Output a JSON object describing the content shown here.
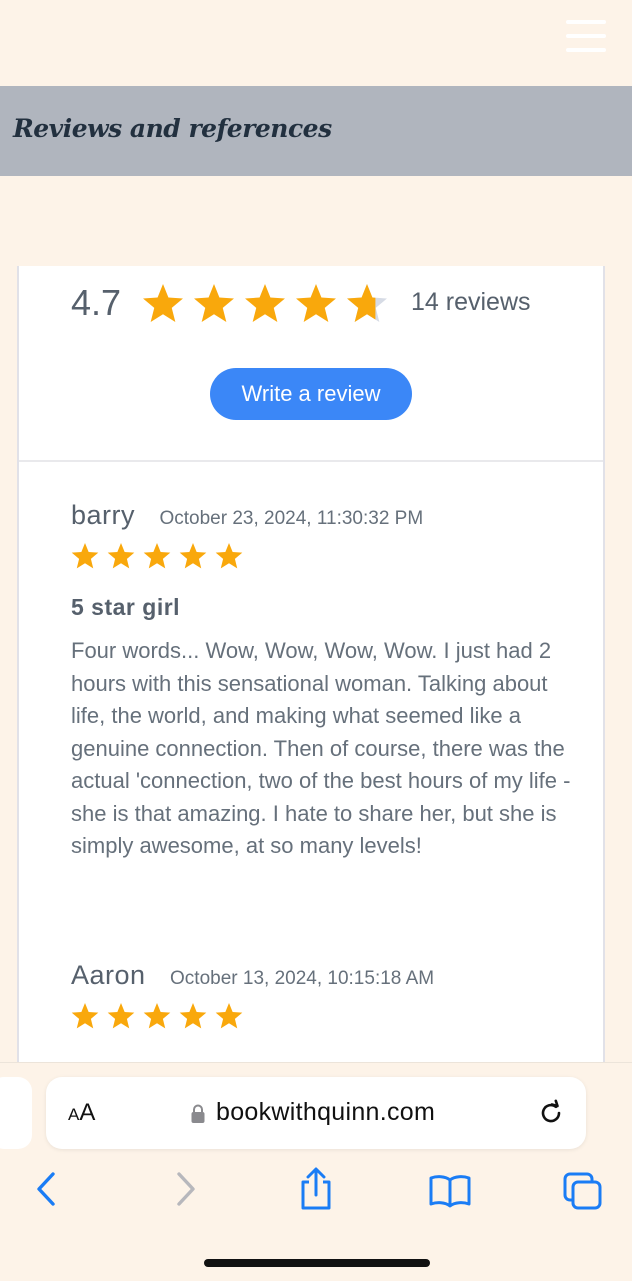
{
  "header": {
    "menu_icon": "hamburger-icon"
  },
  "banner": {
    "title": "Reviews and references"
  },
  "summary": {
    "average": "4.7",
    "rating_value": 4.7,
    "count_text": "14 reviews",
    "write_review_label": "Write a review"
  },
  "reviews": [
    {
      "name": "barry",
      "date": "October 23, 2024, 11:30:32 PM",
      "rating": 5,
      "title": "5 star girl",
      "text": "Four words... Wow, Wow, Wow, Wow. I just had 2 hours with this sensational woman. Talking about life, the world, and making what seemed like a genuine connection. Then of course, there was the actual 'connection, two of the best hours of my life - she is that amazing. I hate to share her, but she is simply awesome, at so many levels!"
    },
    {
      "name": "Aaron",
      "date": "October 13, 2024, 10:15:18 AM",
      "rating": 5
    }
  ],
  "browser": {
    "aa_small": "A",
    "aa_large": "A",
    "domain": "bookwithquinn.com"
  },
  "colors": {
    "star": "#f9a80c",
    "star_empty": "#d6dbe5",
    "accent": "#3b87f7",
    "ios_blue": "#1a7cf5"
  }
}
